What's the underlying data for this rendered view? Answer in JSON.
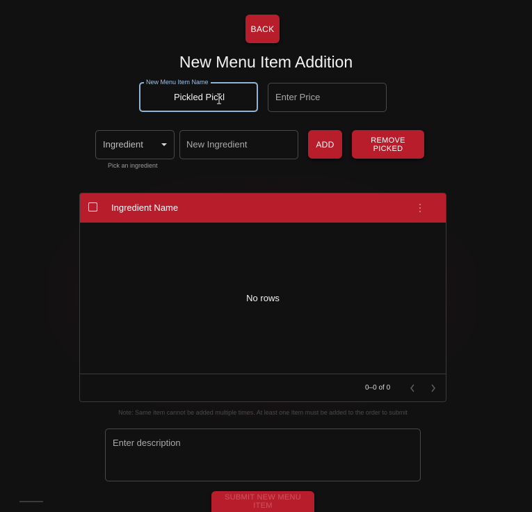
{
  "header": {
    "back_label": "BACK",
    "title": "New Menu Item Addition"
  },
  "form": {
    "name_label": "New Menu Item Name",
    "name_value": "Pickled Pickl",
    "price_placeholder": "Enter Price",
    "ingredient_select_value": "Ingredient",
    "ingredient_helper": "Pick an ingredient",
    "new_ingredient_placeholder": "New Ingredient",
    "add_label": "ADD",
    "remove_label": "REMOVE PICKED",
    "description_placeholder": "Enter description"
  },
  "grid": {
    "column_header": "Ingredient Name",
    "empty_text": "No rows",
    "pagination": "0–0 of 0"
  },
  "note": "Note: Same item cannot be added multiple times. At least one Item must be added to the order to submit",
  "submit_label": "SUBMIT NEW MENU ITEM",
  "colors": {
    "accent": "#b81d2b",
    "background": "#121112",
    "focus": "#90b4da"
  }
}
